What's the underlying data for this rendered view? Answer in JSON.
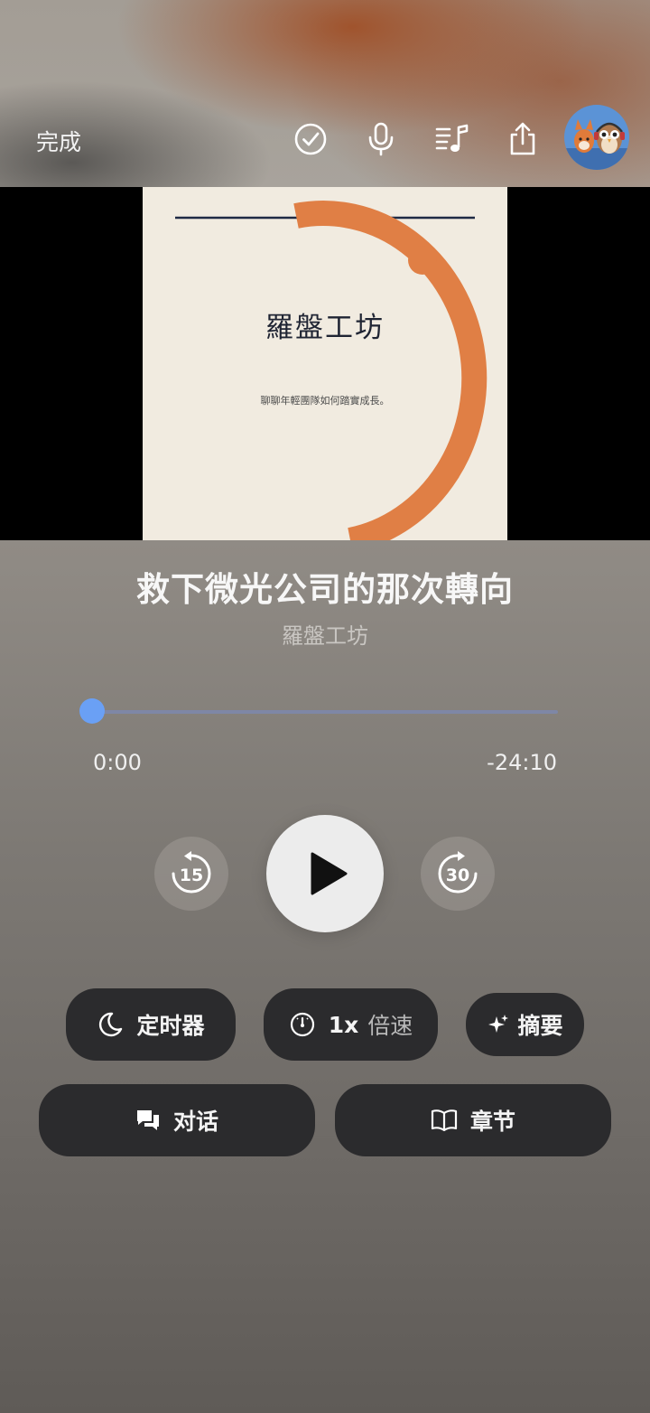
{
  "header": {
    "done_label": "完成",
    "icons": [
      "checkmark-circle-icon",
      "microphone-icon",
      "playlist-music-icon",
      "share-icon",
      "avatar-image"
    ]
  },
  "cover": {
    "title": "羅盤工坊",
    "subtitle": "聊聊年輕團隊如何踏實成長。",
    "colors": {
      "background": "#f1ebe0",
      "accent": "#e07f45",
      "line": "#1f2a44"
    }
  },
  "track": {
    "title": "救下微光公司的那次轉向",
    "artist": "羅盤工坊"
  },
  "progress": {
    "elapsed": "0:00",
    "remaining": "-24:10",
    "fraction": 0.0,
    "accent": "#6aa0f5"
  },
  "controls": {
    "skip_back": "15",
    "skip_forward": "30"
  },
  "actions": {
    "timer_label": "定时器",
    "speed_value": "1x",
    "speed_label": "倍速",
    "summary_label": "摘要",
    "dialogue_label": "对话",
    "chapters_label": "章节"
  }
}
